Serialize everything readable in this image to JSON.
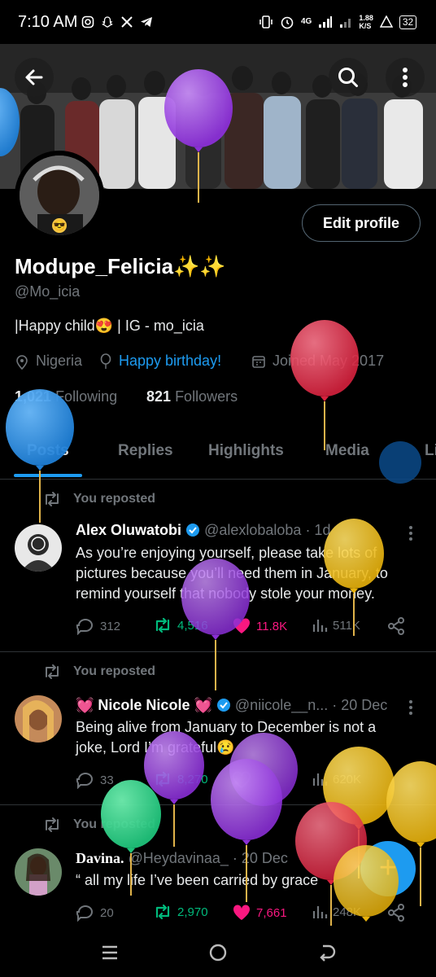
{
  "status_bar": {
    "time": "7:10 AM",
    "network": "4G",
    "speed_value": "1.88",
    "speed_unit": "K/S",
    "battery": "32"
  },
  "profile": {
    "display_name": "Modupe_Felicia✨✨",
    "handle": "@Mo_icia",
    "bio": "|Happy child😍 | IG - mo_icia",
    "location": "Nigeria",
    "birthday": "Happy birthday!",
    "joined": "Joined May 2017",
    "following_count": "1,021",
    "following_label": "Following",
    "followers_count": "821",
    "followers_label": "Followers",
    "edit_label": "Edit profile"
  },
  "tabs": [
    {
      "label": "Posts",
      "active": true
    },
    {
      "label": "Replies"
    },
    {
      "label": "Highlights"
    },
    {
      "label": "Media"
    },
    {
      "label": "Li"
    }
  ],
  "posts": [
    {
      "repost_label": "You reposted",
      "author": "Alex Oluwatobi",
      "handle": "@alexlobaloba",
      "time": "· 1d",
      "text": "As you’re enjoying yourself, please take lots of pictures because you’ll need them in January, to remind yourself that nobody stole your money.",
      "replies": "312",
      "reposts": "4,516",
      "likes": "11.8K",
      "views": "511K"
    },
    {
      "repost_label": "You reposted",
      "author": "💓 Nicole Nicole 💓",
      "handle": "@niicole__n...",
      "time": "· 20 Dec",
      "text": "Being alive from January to December is not a joke, Lord I’m grateful😢",
      "replies": "33",
      "reposts": "8,270",
      "likes": "",
      "views": "620K"
    },
    {
      "repost_label": "You reposted",
      "author": "Davina.",
      "handle": "@Heydavinaa_",
      "time": "· 20 Dec",
      "text": "“ all my life I’ve been carried by grace",
      "replies": "20",
      "reposts": "2,970",
      "likes": "7,661",
      "views": "248K"
    }
  ],
  "fab_label": "+",
  "colors": {
    "accent": "#1d9bf0",
    "repost_green": "#00ba7c",
    "like_pink": "#f91880",
    "muted": "#71767b",
    "balloon_purple": "#9b3fe0",
    "balloon_red": "#e0304f",
    "balloon_yellow": "#f2c21a",
    "balloon_blue": "#2f8ee6",
    "balloon_green": "#2bd184"
  }
}
